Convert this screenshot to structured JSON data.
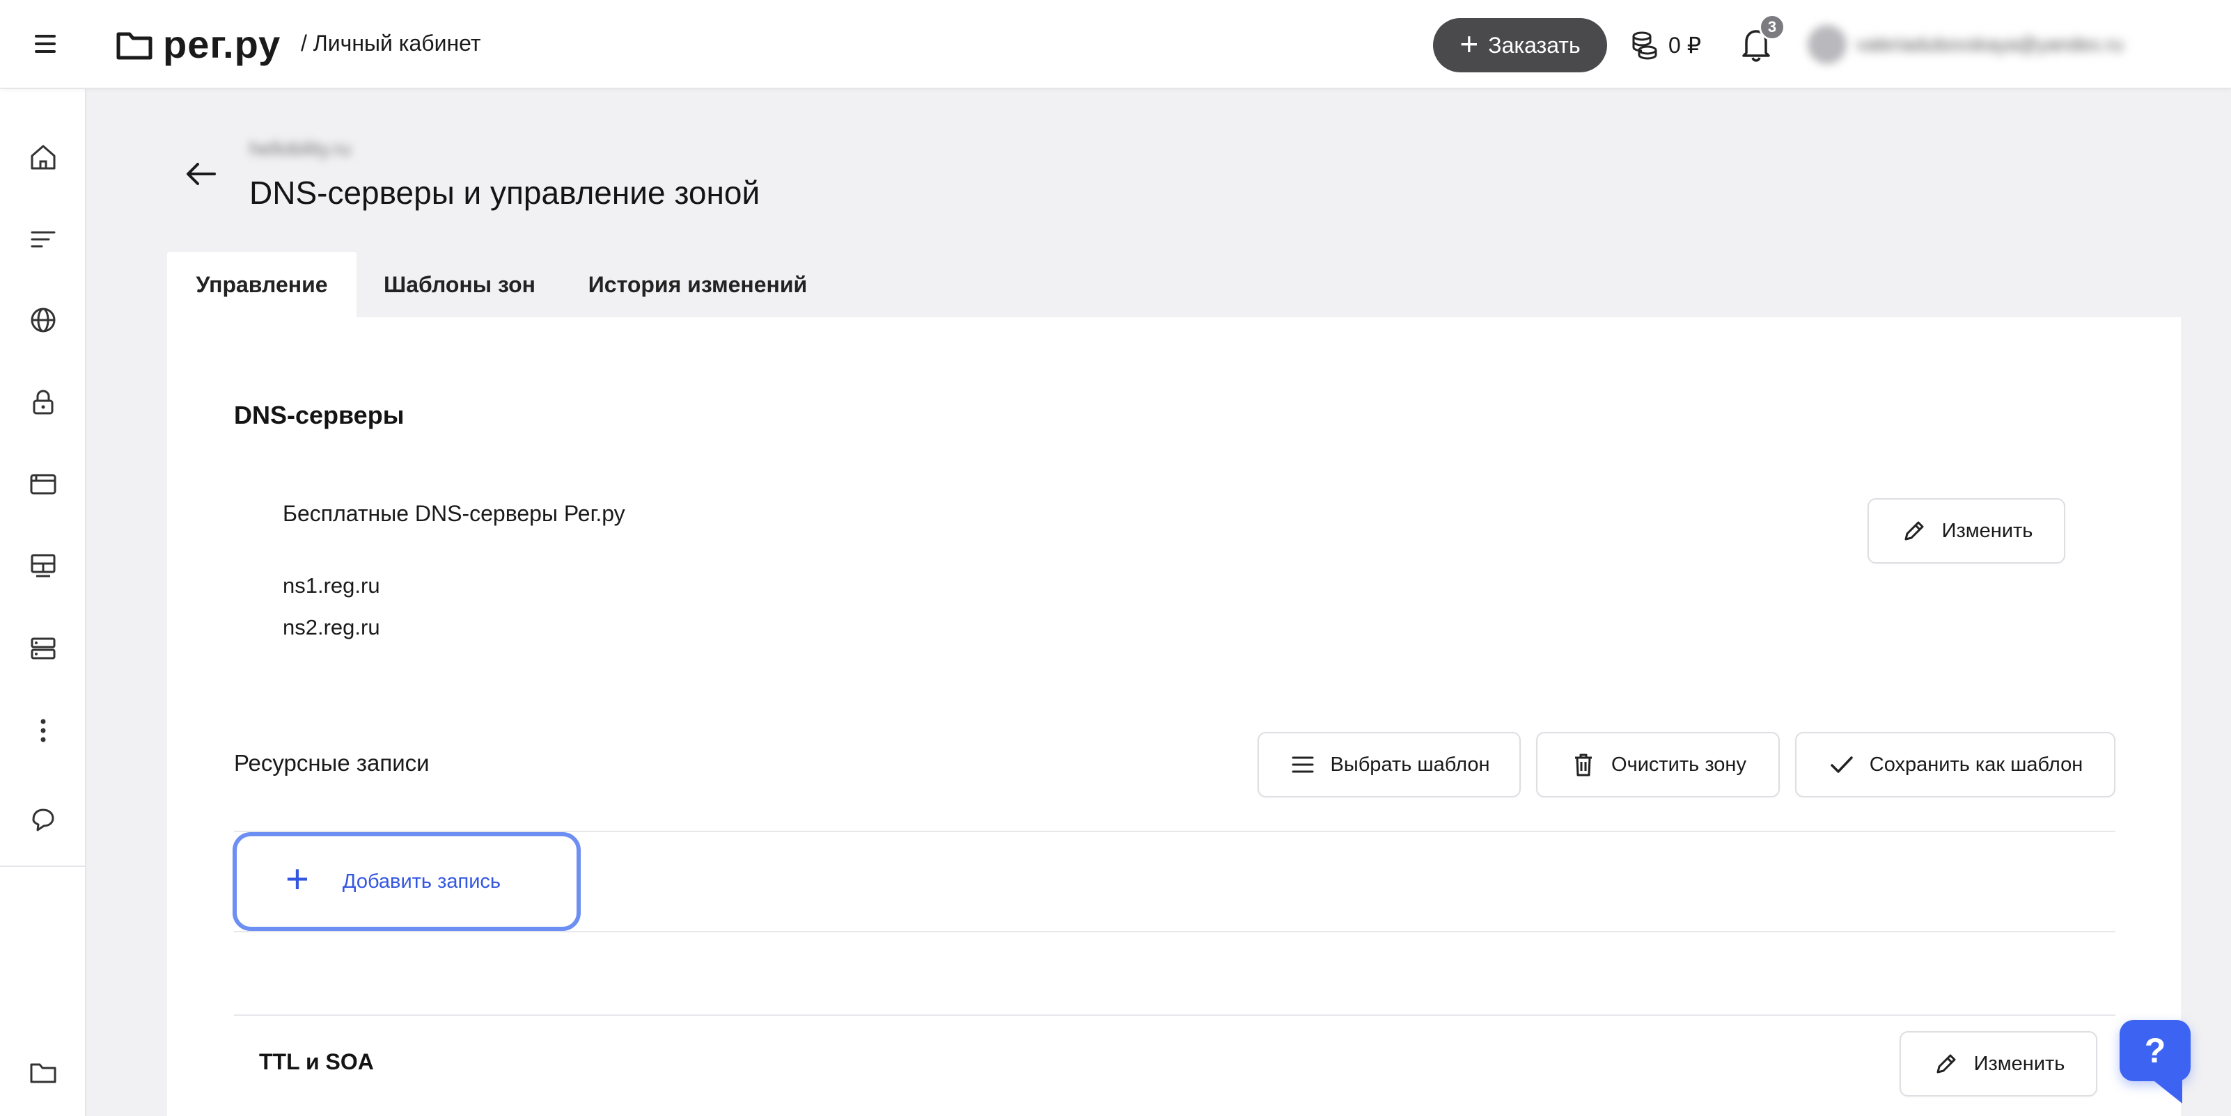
{
  "header": {
    "logo_text": "рег.ру",
    "cabinet_label": "/ Личный кабинет",
    "order_button": "Заказать",
    "balance": "0 ₽",
    "notifications_count": "3",
    "user_email": "valeriadubovskaya@yandex.ru"
  },
  "page": {
    "domain": "hellobility.ru",
    "title": "DNS-серверы и управление зоной"
  },
  "tabs": [
    {
      "label": "Управление",
      "active": true
    },
    {
      "label": "Шаблоны зон",
      "active": false
    },
    {
      "label": "История изменений",
      "active": false
    }
  ],
  "dns_servers": {
    "heading": "DNS-серверы",
    "provider": "Бесплатные DNS-серверы Рег.ру",
    "servers": [
      "ns1.reg.ru",
      "ns2.reg.ru"
    ],
    "edit_button": "Изменить"
  },
  "resource_records": {
    "heading": "Ресурсные записи",
    "choose_template": "Выбрать шаблон",
    "clear_zone": "Очистить зону",
    "save_template": "Сохранить как шаблон",
    "add_record": "Добавить запись"
  },
  "ttl_soa": {
    "heading": "TTL и SOA",
    "edit_button": "Изменить"
  },
  "help_button": "?",
  "colors": {
    "accent": "#3457e0",
    "focus_ring": "#6d8ef2",
    "help_button": "#3d63f2",
    "order_button": "#4a4a4d"
  }
}
